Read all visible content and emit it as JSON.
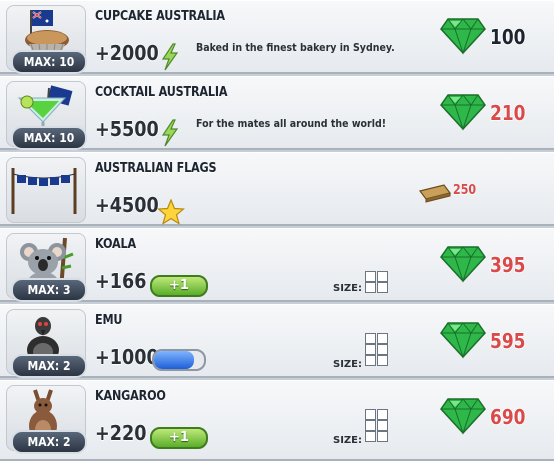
{
  "items": [
    {
      "title": "CUPCAKE AUSTRALIA",
      "max": "MAX: 10",
      "bonus": "+2000",
      "bonus_icon": "lightning-bolt-icon",
      "description": "Baked in the finest bakery in Sydney.",
      "price": "100",
      "price_currency": "green-gem-icon",
      "price_color": "black"
    },
    {
      "title": "COCKTAIL AUSTRALIA",
      "max": "MAX: 10",
      "bonus": "+5500",
      "bonus_icon": "lightning-bolt-icon",
      "description": "For the mates all around the world!",
      "price": "210",
      "price_currency": "green-gem-icon",
      "price_color": "red"
    },
    {
      "title": "AUSTRALIAN FLAGS",
      "bonus": "+4500",
      "bonus_icon": "star-icon",
      "price": "250",
      "price_currency": "wood-plank-icon",
      "price_color": "red"
    },
    {
      "title": "KOALA",
      "max": "MAX: 3",
      "bonus": "+166",
      "energy_plus": "+1",
      "size_label": "SIZE:",
      "size_cells": 4,
      "price": "395",
      "price_currency": "green-gem-icon",
      "price_color": "red"
    },
    {
      "title": "EMU",
      "max": "MAX: 2",
      "bonus": "+1000",
      "bar_fill": 0.8,
      "size_label": "SIZE:",
      "size_cells": 6,
      "price": "595",
      "price_currency": "green-gem-icon",
      "price_color": "red"
    },
    {
      "title": "KANGAROO",
      "max": "MAX: 2",
      "bonus": "+220",
      "energy_plus": "+1",
      "size_label": "SIZE:",
      "size_cells": 6,
      "price": "690",
      "price_currency": "green-gem-icon",
      "price_color": "red"
    }
  ],
  "colors": {
    "price_red": "#d94a4a",
    "gem_green": "#2fb84a",
    "energy_green": "#5aae2a"
  }
}
